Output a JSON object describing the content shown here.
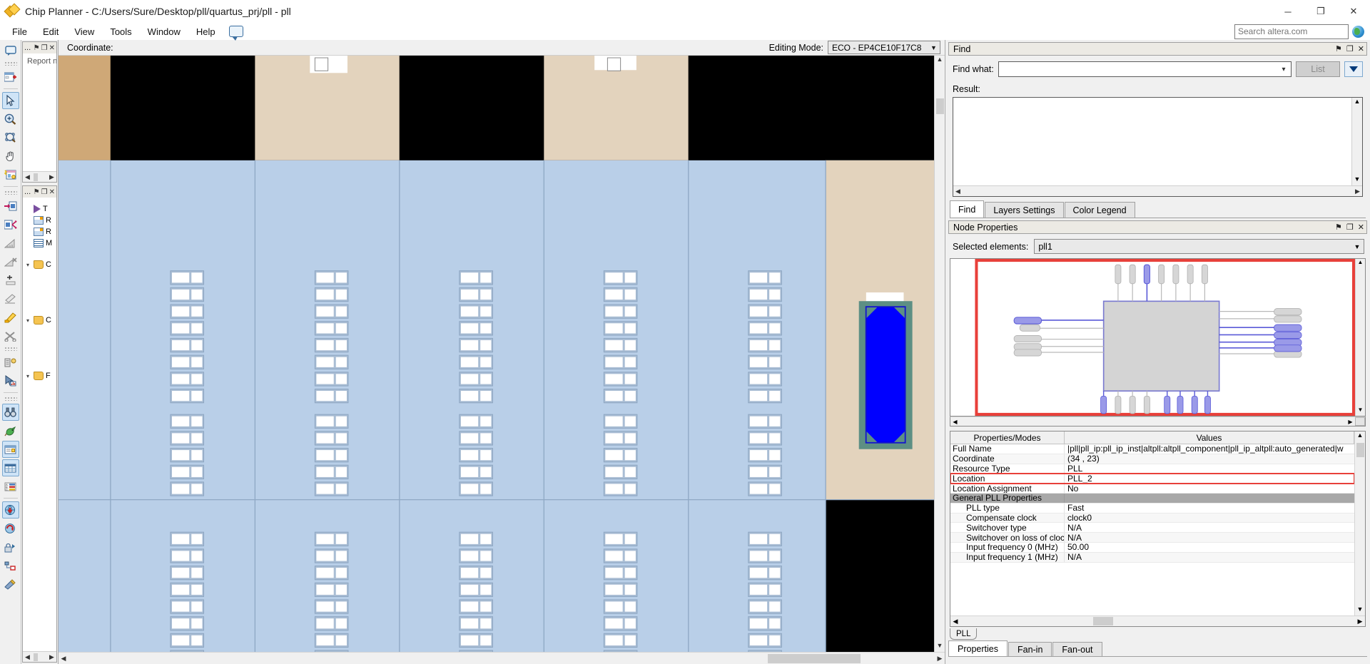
{
  "window": {
    "title": "Chip Planner - C:/Users/Sure/Desktop/pll/quartus_prj/pll - pll",
    "minimize": "─",
    "maximize": "❐",
    "close": "✕"
  },
  "menu": {
    "items": [
      "File",
      "Edit",
      "View",
      "Tools",
      "Window",
      "Help"
    ]
  },
  "search": {
    "placeholder": "Search altera.com",
    "value": ""
  },
  "left_toolbar": {
    "icons": [
      "comment-balloon-icon",
      "new-report-icon",
      "select-arrow-icon",
      "zoom-in-icon",
      "zoom-region-icon",
      "pan-hand-icon",
      "highlight-routing-icon",
      "insert-node-icon",
      "fan-out-icon",
      "ruler-icon",
      "delete-path-icon",
      "add-row-icon",
      "erase-icon",
      "highlighter-icon",
      "cut-icon",
      "bus-properties-icon",
      "report-chart-icon",
      "find-binoculars-icon",
      "bird-icon",
      "node-properties-icon",
      "table-view-icon",
      "legend-icon",
      "globe-download-icon",
      "refresh-icon",
      "lock-icon",
      "connect-icon",
      "paint-icon"
    ]
  },
  "left_panels": [
    {
      "title": "...",
      "content": "Report no",
      "pin": "⚑",
      "restore": "❐",
      "close": "✕"
    },
    {
      "title": "...",
      "pin": "⚑",
      "restore": "❐",
      "close": "✕",
      "tree": [
        {
          "icon": "play-icon",
          "label": "T"
        },
        {
          "icon": "window-icon",
          "label": "R"
        },
        {
          "icon": "window-icon",
          "label": "R"
        },
        {
          "icon": "table-icon",
          "label": "M"
        },
        {
          "icon": "folder-icon",
          "label": "C",
          "expanded": true
        },
        {
          "icon": "folder-icon",
          "label": "C",
          "expanded": true
        },
        {
          "icon": "folder-icon",
          "label": "F",
          "expanded": true
        }
      ]
    }
  ],
  "canvas": {
    "coordinate_label": "Coordinate:",
    "coordinate_value": "",
    "editing_mode_label": "Editing Mode:",
    "editing_mode_value": "ECO - EP4CE10F17C8",
    "colors": {
      "lab_background": "#b9cfe8",
      "io_band_tan": "#cfa877",
      "io_band_light": "#e3d3bd",
      "empty_black": "#000000",
      "pll_fill": "#0000ff",
      "pll_border": "#5d8f84"
    },
    "pll_block": {
      "label": "",
      "selected": true
    }
  },
  "find_panel": {
    "title": "Find",
    "pin": "⚑",
    "restore": "❐",
    "close": "✕",
    "find_what_label": "Find what:",
    "find_what_value": "",
    "find_what_placeholder": "",
    "list_button": "List",
    "result_label": "Result:",
    "result_items": [],
    "tabs": [
      {
        "label": "Find",
        "active": true
      },
      {
        "label": "Layers Settings",
        "active": false
      },
      {
        "label": "Color Legend",
        "active": false
      }
    ]
  },
  "node_properties": {
    "title": "Node Properties",
    "pin": "⚑",
    "restore": "❐",
    "close": "✕",
    "selected_elements_label": "Selected elements:",
    "selected_elements_value": "pll1",
    "table": {
      "headers": [
        "Properties/Modes",
        "Values"
      ],
      "rows": [
        {
          "name": "Full Name",
          "value": "|pll|pll_ip:pll_ip_inst|altpll:altpll_component|pll_ip_altpll:auto_generated|w",
          "group": false,
          "indent": false,
          "highlight": false
        },
        {
          "name": "Coordinate",
          "value": "(34 , 23)",
          "group": false,
          "indent": false,
          "highlight": false
        },
        {
          "name": "Resource Type",
          "value": "PLL",
          "group": false,
          "indent": false,
          "highlight": false
        },
        {
          "name": "Location",
          "value": "PLL_2",
          "group": false,
          "indent": false,
          "highlight": true
        },
        {
          "name": "Location Assignment",
          "value": "No",
          "group": false,
          "indent": false,
          "highlight": false
        },
        {
          "name": "General PLL Properties",
          "value": "",
          "group": true,
          "indent": false,
          "highlight": false
        },
        {
          "name": "PLL type",
          "value": "Fast",
          "group": false,
          "indent": true,
          "highlight": false
        },
        {
          "name": "Compensate clock",
          "value": "clock0",
          "group": false,
          "indent": true,
          "highlight": false
        },
        {
          "name": "Switchover type",
          "value": "N/A",
          "group": false,
          "indent": true,
          "highlight": false
        },
        {
          "name": "Switchover on loss of clock",
          "value": "N/A",
          "group": false,
          "indent": true,
          "highlight": false
        },
        {
          "name": "Input frequency 0 (MHz)",
          "value": "50.00",
          "group": false,
          "indent": true,
          "highlight": false
        },
        {
          "name": "Input frequency 1 (MHz)",
          "value": "N/A",
          "group": false,
          "indent": true,
          "highlight": false
        }
      ]
    },
    "sub_tab": "PLL",
    "bottom_tabs": [
      {
        "label": "Properties",
        "active": true
      },
      {
        "label": "Fan-in",
        "active": false
      },
      {
        "label": "Fan-out",
        "active": false
      }
    ],
    "highlight_color": "#e8403a"
  }
}
